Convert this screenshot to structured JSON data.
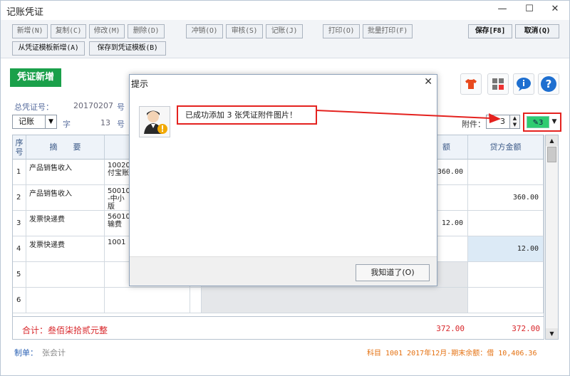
{
  "window": {
    "title": "记账凭证",
    "minimize": "—",
    "maximize": "☐",
    "close": "✕"
  },
  "toolbar": {
    "new": "新增(N)",
    "copy": "复制(C)",
    "edit": "修改(M)",
    "delete": "删除(D)",
    "reverse": "冲销(O)",
    "audit": "审核(S)",
    "post": "记账(J)",
    "print": "打印(O)",
    "batch_print": "批量打印(F)",
    "save": "保存[F8]",
    "cancel": "取消(Q)",
    "new_from_template": "从凭证模板新增(A)",
    "save_as_template": "保存到凭证模板(B)"
  },
  "header": {
    "heading": "凭证新增",
    "voucher_no_label": "总凭证号：",
    "voucher_no": "20170207",
    "voucher_no_suffix": "号",
    "voucher_type": "记账",
    "word_label": "字",
    "sub_no": "13",
    "sub_no_suffix": "号",
    "attachments_label": "附件：",
    "attachments_count": "3",
    "attach_button_count": "3",
    "attach_button_icon": "paperclip-icon"
  },
  "header_icons": [
    "shirt-icon",
    "calculator-icon",
    "chat-icon",
    "help-icon"
  ],
  "table": {
    "columns": {
      "row_no": "序号",
      "summary": "摘　　要",
      "debit": "额",
      "credit": "贷方金额"
    },
    "rows": [
      {
        "no": "1",
        "summary": "产品销售收入",
        "account": "10020\n付宝账",
        "debit": "360.00",
        "credit": ""
      },
      {
        "no": "2",
        "summary": "产品销售收入",
        "account": "50010\n-中小\n版",
        "debit": "",
        "credit": "360.00"
      },
      {
        "no": "3",
        "summary": "发票快递费",
        "account": "56010\n输费",
        "debit": "12.00",
        "credit": ""
      },
      {
        "no": "4",
        "summary": "发票快递费",
        "account": "1001",
        "debit": "",
        "credit": "12.00"
      },
      {
        "no": "5",
        "summary": "",
        "account": "",
        "debit": "",
        "credit": ""
      },
      {
        "no": "6",
        "summary": "",
        "account": "",
        "debit": "",
        "credit": ""
      }
    ],
    "total_label": "合计：叁佰柒拾贰元整",
    "total_debit": "372.00",
    "total_credit": "372.00"
  },
  "footer": {
    "maker_label": "制单：",
    "maker": "张会计",
    "balance": "科目 1001  2017年12月-期末余额：借 10,406.36"
  },
  "dialog": {
    "title": "提示",
    "close": "✕",
    "message": "已成功添加 3 张凭证附件图片！",
    "ok_button": "我知道了(O)"
  },
  "colors": {
    "accent_green": "#1aa04a",
    "annotation_red": "#e4221f",
    "total_red": "#d8262a",
    "footer_orange": "#e47010"
  }
}
